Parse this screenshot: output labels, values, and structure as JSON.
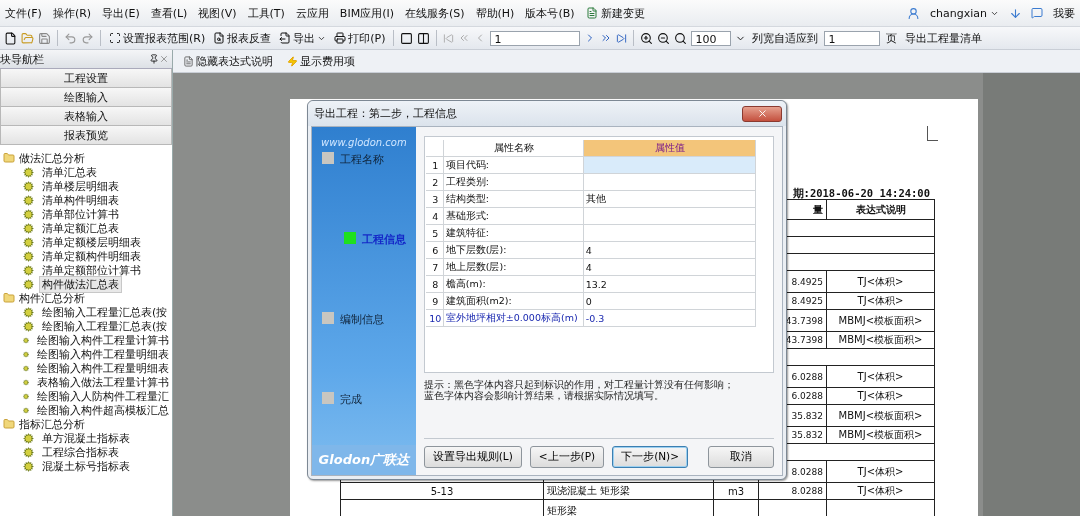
{
  "menu": [
    {
      "label": "文件(F)",
      "kind": "plain"
    },
    {
      "label": "操作(R)",
      "kind": "plain"
    },
    {
      "label": "导出(E)",
      "kind": "plain"
    },
    {
      "label": "查看(L)",
      "kind": "plain"
    },
    {
      "label": "视图(V)",
      "kind": "plain"
    },
    {
      "label": "工具(T)",
      "kind": "plain"
    },
    {
      "label": "云应用",
      "kind": "plain"
    },
    {
      "label": "BIM应用(I)",
      "kind": "plain"
    },
    {
      "label": "在线服务(S)",
      "kind": "plain"
    },
    {
      "label": "帮助(H)",
      "kind": "plain"
    },
    {
      "label": "版本号(B)",
      "kind": "plain"
    },
    {
      "label": "新建变更",
      "kind": "icon"
    }
  ],
  "user": {
    "name": "changxian",
    "link": "我要"
  },
  "toolbar": {
    "range": "设置报表范围(R)",
    "lookup": "报表反查",
    "export": "导出",
    "print": "打印(P)",
    "page": "1",
    "zoom": "100",
    "fit_label": "列宽自适应到",
    "fit_value": "1",
    "fit_unit": "页",
    "export_list": "导出工程量清单"
  },
  "subtoolbar": [
    "隐藏表达式说明",
    "显示费用项"
  ],
  "nav": {
    "title": "块导航栏",
    "buttons": [
      "工程设置",
      "绘图输入",
      "表格输入",
      "报表预览"
    ],
    "groups": [
      {
        "label": "做法汇总分析",
        "children": [
          {
            "label": "清单汇总表",
            "selected": false
          },
          {
            "label": "清单楼层明细表",
            "selected": false
          },
          {
            "label": "清单构件明细表",
            "selected": false
          },
          {
            "label": "清单部位计算书",
            "selected": false
          },
          {
            "label": "清单定额汇总表",
            "selected": false
          },
          {
            "label": "清单定额楼层明细表",
            "selected": false
          },
          {
            "label": "清单定额构件明细表",
            "selected": false
          },
          {
            "label": "清单定额部位计算书",
            "selected": false
          },
          {
            "label": "构件做法汇总表",
            "selected": true
          }
        ]
      },
      {
        "label": "构件汇总分析",
        "children": [
          {
            "label": "绘图输入工程量汇总表(按",
            "selected": false
          },
          {
            "label": "绘图输入工程量汇总表(按",
            "selected": false
          },
          {
            "label": "绘图输入构件工程量计算书",
            "selected": false
          },
          {
            "label": "绘图输入构件工程量明细表",
            "selected": false
          },
          {
            "label": "绘图输入构件工程量明细表",
            "selected": false
          },
          {
            "label": "表格输入做法工程量计算书",
            "selected": false
          },
          {
            "label": "绘图输入人防构件工程量汇",
            "selected": false
          },
          {
            "label": "绘图输入构件超高模板汇总",
            "selected": false
          }
        ]
      },
      {
        "label": "指标汇总分析",
        "children": [
          {
            "label": "单方混凝土指标表",
            "selected": false
          },
          {
            "label": "工程综合指标表",
            "selected": false
          },
          {
            "label": "混凝土标号指标表",
            "selected": false
          }
        ]
      }
    ]
  },
  "report": {
    "date": "期:2018-06-20 14:24:00",
    "quantity_header": "量",
    "expression_header": "表达式说明",
    "rows": [
      {
        "kind": "group"
      },
      {
        "kind": "group"
      },
      {
        "kind": "group"
      },
      {
        "kind": "item",
        "quantity": "8.4925",
        "expression": "TJ<体积>"
      },
      {
        "kind": "item",
        "quantity": "8.4925",
        "expression": "TJ<体积>"
      },
      {
        "kind": "item",
        "quantity": "43.7398",
        "expression": "MBMJ<模板面积>"
      },
      {
        "kind": "item",
        "quantity": "43.7398",
        "expression": "MBMJ<模板面积>"
      },
      {
        "kind": "group"
      },
      {
        "kind": "item",
        "quantity": "6.0288",
        "expression": "TJ<体积>"
      },
      {
        "kind": "item",
        "quantity": "6.0288",
        "expression": "TJ<体积>"
      },
      {
        "kind": "item",
        "quantity": "35.832",
        "expression": "MBMJ<模板面积>"
      },
      {
        "kind": "item",
        "quantity": "35.832",
        "expression": "MBMJ<模板面积>"
      },
      {
        "kind": "group"
      },
      {
        "kind": "item",
        "quantity": "8.0288",
        "expression": "TJ<体积>"
      },
      {
        "kind": "item",
        "code": "5-13",
        "name": "现浇混凝土 矩形梁",
        "unit": "m3",
        "quantity": "8.0288",
        "expression": "TJ<体积>"
      },
      {
        "kind": "item",
        "name": "矩形梁"
      }
    ]
  },
  "dialog": {
    "title": "导出工程：第二步，工程信息",
    "site": "www.glodon.com",
    "logo": "Glodon广联达",
    "steps": [
      {
        "label": "工程名称",
        "selected": false
      },
      {
        "label": "工程信息",
        "selected": true
      },
      {
        "label": "编制信息",
        "selected": false
      },
      {
        "label": "完成",
        "selected": false
      }
    ],
    "columns": [
      "属性名称",
      "属性值"
    ],
    "properties": [
      {
        "num": "1",
        "name": "项目代码:",
        "kind": "info",
        "selected": true
      },
      {
        "num": "2",
        "name": "工程类别:",
        "kind": "info",
        "selected": false
      },
      {
        "num": "3",
        "name": "结构类型:",
        "value": "其他",
        "kind": "info",
        "selected": false
      },
      {
        "num": "4",
        "name": "基础形式:",
        "kind": "info",
        "selected": false
      },
      {
        "num": "5",
        "name": "建筑特征:",
        "kind": "info",
        "selected": false
      },
      {
        "num": "6",
        "name": "地下层数(层):",
        "value": "4",
        "kind": "info",
        "selected": false
      },
      {
        "num": "7",
        "name": "地上层数(层):",
        "value": "4",
        "kind": "info",
        "selected": false
      },
      {
        "num": "8",
        "name": "檐高(m):",
        "value": "13.2",
        "kind": "info",
        "selected": false
      },
      {
        "num": "9",
        "name": "建筑面积(m2):",
        "value": "0",
        "kind": "info",
        "selected": false
      },
      {
        "num": "10",
        "name": "室外地坪相对±0.000标高(m)",
        "value": "-0.3",
        "kind": "calc",
        "selected": false
      }
    ],
    "hint": "提示：黑色字体内容只起到标识的作用，对工程量计算没有任何影响；蓝色字体内容会影响计算结果，请根据实际情况填写。",
    "buttons": [
      {
        "label": "设置导出规则(L)",
        "focused": false
      },
      {
        "label": "<上一步(P)",
        "focused": false
      },
      {
        "label": "下一步(N)>",
        "focused": true
      },
      {
        "label": "取消",
        "focused": false
      }
    ]
  }
}
